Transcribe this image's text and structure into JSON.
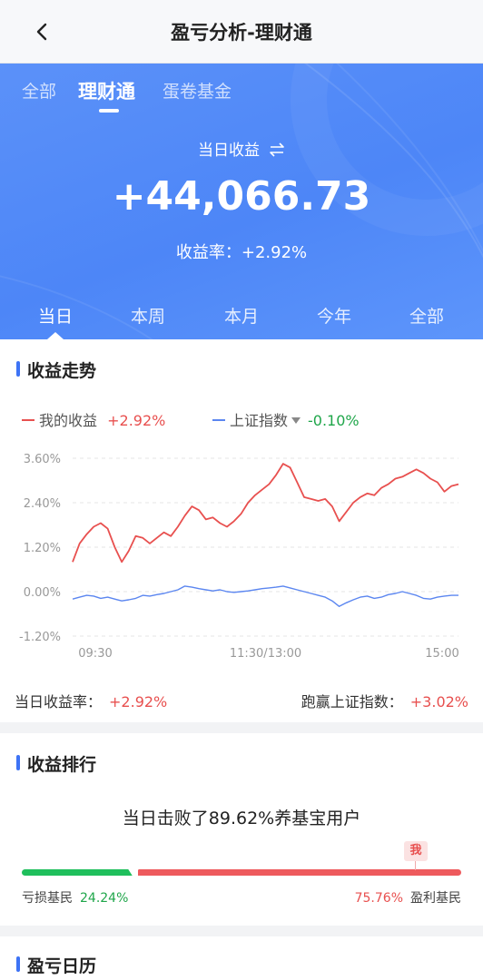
{
  "header": {
    "title": "盈亏分析-理财通"
  },
  "top_tabs": [
    {
      "label": "全部"
    },
    {
      "label": "理财通"
    },
    {
      "label": "蛋卷基金"
    }
  ],
  "summary": {
    "day_label": "当日收益",
    "amount": "+44,066.73",
    "rate_label": "收益率：",
    "rate_value": "+2.92%"
  },
  "period_tabs": [
    {
      "label": "当日"
    },
    {
      "label": "本周"
    },
    {
      "label": "本月"
    },
    {
      "label": "今年"
    },
    {
      "label": "全部"
    }
  ],
  "trend": {
    "title": "收益走势",
    "my_label": "我的收益",
    "my_value": "+2.92%",
    "index_label": "上证指数",
    "index_value": "-0.10%",
    "footer_rate_label": "当日收益率：",
    "footer_rate_value": "+2.92%",
    "footer_beat_label": "跑赢上证指数：",
    "footer_beat_value": "+3.02%"
  },
  "chart_data": {
    "type": "line",
    "title": "",
    "xlabel": "",
    "ylabel": "",
    "ylim": [
      -1.2,
      3.6
    ],
    "y_ticks": [
      "3.60%",
      "2.40%",
      "1.20%",
      "0.00%",
      "-1.20%"
    ],
    "x_ticks": [
      "09:30",
      "11:30/13:00",
      "15:00"
    ],
    "grid": "horizontal-dashed",
    "legend": "top-left",
    "series": [
      {
        "name": "我的收益",
        "color": "#e8504f",
        "values": [
          0.8,
          1.3,
          1.55,
          1.75,
          1.85,
          1.7,
          1.2,
          0.8,
          1.1,
          1.5,
          1.45,
          1.3,
          1.45,
          1.6,
          1.5,
          1.75,
          2.05,
          2.3,
          2.2,
          1.95,
          2.0,
          1.85,
          1.75,
          1.9,
          2.1,
          2.4,
          2.6,
          2.75,
          2.9,
          3.15,
          3.45,
          3.35,
          2.95,
          2.55,
          2.5,
          2.45,
          2.5,
          2.3,
          1.9,
          2.15,
          2.4,
          2.55,
          2.65,
          2.6,
          2.8,
          2.9,
          3.05,
          3.1,
          3.2,
          3.3,
          3.2,
          3.05,
          2.95,
          2.7,
          2.85,
          2.9
        ]
      },
      {
        "name": "上证指数",
        "color": "#5b86f0",
        "values": [
          -0.2,
          -0.15,
          -0.1,
          -0.12,
          -0.18,
          -0.15,
          -0.2,
          -0.25,
          -0.22,
          -0.18,
          -0.1,
          -0.12,
          -0.08,
          -0.05,
          0.0,
          0.05,
          0.15,
          0.12,
          0.08,
          0.05,
          0.02,
          0.05,
          0.0,
          -0.02,
          0.0,
          0.02,
          0.05,
          0.08,
          0.1,
          0.12,
          0.15,
          0.1,
          0.05,
          0.0,
          -0.05,
          -0.1,
          -0.15,
          -0.25,
          -0.4,
          -0.3,
          -0.22,
          -0.15,
          -0.12,
          -0.18,
          -0.15,
          -0.08,
          -0.05,
          0.0,
          -0.05,
          -0.1,
          -0.18,
          -0.2,
          -0.15,
          -0.12,
          -0.1,
          -0.1
        ]
      }
    ]
  },
  "ranking": {
    "title": "收益排行",
    "beat_text": "当日击败了89.62%养基宝用户",
    "me_badge": "我",
    "loss_label": "亏损基民",
    "loss_value": "24.24%",
    "profit_value": "75.76%",
    "profit_label": "盈利基民",
    "loss_share": 0.2424,
    "me_percentile": 0.8962
  },
  "calendar": {
    "title": "盈亏日历"
  },
  "colors": {
    "primary": "#4d86f7",
    "up": "#e8504f",
    "down": "#1fa64a"
  }
}
